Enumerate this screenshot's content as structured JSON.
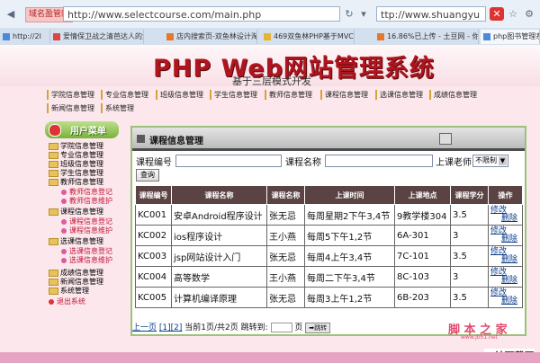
{
  "browser": {
    "cert_badge": "域名盈管网",
    "url": "http://www.selectcourse.com/main.php",
    "second_url": "ttp://www.shuangyu",
    "tabs": [
      {
        "label": "http://2l",
        "color": "#4a8ad8"
      },
      {
        "label": "爱情保卫战之清芭达人的爱情",
        "color": "#d44"
      },
      {
        "label": "店内搜索页-双鱼林设计淘宝",
        "color": "#e8772e"
      },
      {
        "label": "469双鱼林PHP基于MVC三",
        "color": "#e8b42e"
      },
      {
        "label": "16.86%已上传 - 土豆网 - 你",
        "color": "#e8772e"
      },
      {
        "label": "php图书管理系",
        "color": "#4a8ad8"
      }
    ]
  },
  "header": {
    "title": "PHP Web网站管理系统",
    "subtitle": "基于三层模式开发"
  },
  "topnav": [
    "学院信息管理",
    "专业信息管理",
    "班级信息管理",
    "学生信息管理",
    "教师信息管理",
    "课程信息管理",
    "选课信息管理",
    "成绩信息管理",
    "新闻信息管理",
    "系统管理"
  ],
  "sidebar": {
    "title": "用户菜单",
    "items": [
      {
        "label": "学院信息管理",
        "sub": false
      },
      {
        "label": "专业信息管理",
        "sub": false
      },
      {
        "label": "班级信息管理",
        "sub": false
      },
      {
        "label": "学生信息管理",
        "sub": false
      },
      {
        "label": "教师信息管理",
        "sub": false
      },
      {
        "label": "教师信息登记",
        "sub": true
      },
      {
        "label": "教师信息维护",
        "sub": true
      },
      {
        "label": "课程信息管理",
        "sub": false
      },
      {
        "label": "课程信息登记",
        "sub": true
      },
      {
        "label": "课程信息维护",
        "sub": true
      },
      {
        "label": "选课信息管理",
        "sub": false
      },
      {
        "label": "选课信息登记",
        "sub": true
      },
      {
        "label": "选课信息维护",
        "sub": true
      },
      {
        "label": "成绩信息管理",
        "sub": false
      },
      {
        "label": "新闻信息管理",
        "sub": false
      },
      {
        "label": "系统管理",
        "sub": false
      },
      {
        "label": "退出系统",
        "sub": false
      }
    ]
  },
  "panel": {
    "title": "课程信息管理",
    "search": {
      "code_label": "课程编号",
      "name_label": "课程名称",
      "teacher_label": "上课老师:",
      "teacher_select": "不限制",
      "query_button": "查询"
    },
    "columns": [
      "课程编号",
      "课程名称",
      "课程名称",
      "上课时间",
      "上课地点",
      "课程学分",
      "操作"
    ],
    "rows": [
      {
        "code": "KC001",
        "name": "安卓Android程序设计",
        "teacher": "张无忌",
        "time": "每周星期2下午3,4节",
        "place": "9教学楼304",
        "credit": "3.5"
      },
      {
        "code": "KC002",
        "name": "ios程序设计",
        "teacher": "王小燕",
        "time": "每周5下午1,2节",
        "place": "6A-301",
        "credit": "3"
      },
      {
        "code": "KC003",
        "name": "jsp网站设计入门",
        "teacher": "张无忌",
        "time": "每周4上午3,4节",
        "place": "7C-101",
        "credit": "3.5"
      },
      {
        "code": "KC004",
        "name": "高等数学",
        "teacher": "王小燕",
        "time": "每周二下午3,4节",
        "place": "8C-103",
        "credit": "3"
      },
      {
        "code": "KC005",
        "name": "计算机编译原理",
        "teacher": "张无忌",
        "time": "每周3上午1,2节",
        "place": "6B-203",
        "credit": "3.5"
      }
    ],
    "op_edit": "修改",
    "op_delete": "删除"
  },
  "pager": {
    "prev": "上一页",
    "pages": "[1][2]",
    "info": "当前1页/共2页 跳转到:",
    "unit": "页",
    "go": "跳转"
  },
  "watermarks": {
    "main": "脚 本 之 家",
    "url": "www.jb51.net",
    "corner": "IT神下载网"
  }
}
